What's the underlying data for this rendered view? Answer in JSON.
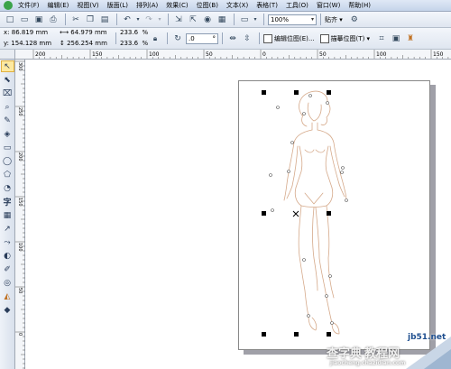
{
  "menu": [
    "文件(F)",
    "编辑(E)",
    "视图(V)",
    "版面(L)",
    "排列(A)",
    "效果(C)",
    "位图(B)",
    "文本(X)",
    "表格(T)",
    "工具(O)",
    "窗口(W)",
    "帮助(H)"
  ],
  "standard_toolbar": {
    "zoom_value": "100%",
    "snap_label": "贴齐"
  },
  "property_bar": {
    "x_label": "x:",
    "x_value": "86.819 mm",
    "y_label": "y:",
    "y_value": "154.128 mm",
    "width_value": "64.979 mm",
    "height_value": "256.254 mm",
    "scale_x": "233.6",
    "scale_y": "233.6",
    "percent": "%",
    "rotation_value": ".0",
    "rotation_unit": "°",
    "edit_bitmap_label": "编辑位图(E)...",
    "trace_bitmap_label": "描摹位图(T)"
  },
  "ruler": {
    "h_ticks": [
      "200",
      "150",
      "100",
      "50",
      "0",
      "50",
      "100",
      "150"
    ],
    "v_ticks": [
      "300",
      "250",
      "200",
      "150",
      "100",
      "50",
      "0"
    ]
  },
  "watermark": {
    "line1": "查字典",
    "line2": "教程网",
    "url": "jb51.net",
    "sub": "jiaocheng.chazidian.com"
  }
}
